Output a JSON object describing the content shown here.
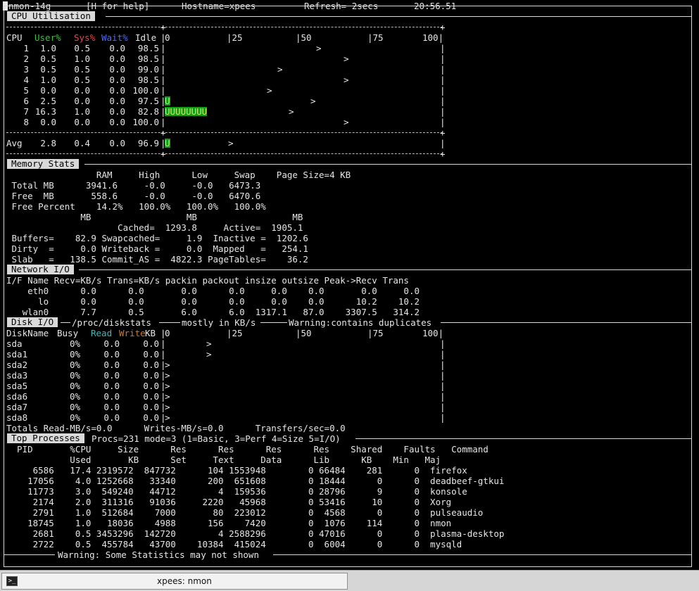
{
  "title_bar": {
    "app": "nmon",
    "version": "14g",
    "help": "[H for help]",
    "hostname": "Hostname=xpees",
    "refresh": "Refresh= 2secs",
    "clock": "20:56.51"
  },
  "cpu": {
    "header": "CPU Utilisation",
    "col_cpu": "CPU",
    "col_user": "User%",
    "col_sys": "Sys%",
    "col_wait": "Wait%",
    "col_idle": "Idle",
    "scale": [
      "0",
      "25",
      "50",
      "75",
      "100"
    ],
    "rows": [
      {
        "cpu": "1",
        "user": "1.0",
        "sys": "0.5",
        "wait": "0.0",
        "idle": "98.5",
        "bar": "",
        "peak": 0.55
      },
      {
        "cpu": "2",
        "user": "0.5",
        "sys": "1.0",
        "wait": "0.0",
        "idle": "98.5",
        "bar": "",
        "peak": 0.65
      },
      {
        "cpu": "3",
        "user": "0.5",
        "sys": "0.5",
        "wait": "0.0",
        "idle": "99.0",
        "bar": "",
        "peak": 0.41
      },
      {
        "cpu": "4",
        "user": "1.0",
        "sys": "0.5",
        "wait": "0.0",
        "idle": "98.5",
        "bar": "",
        "peak": 0.65
      },
      {
        "cpu": "5",
        "user": "0.0",
        "sys": "0.0",
        "wait": "0.0",
        "idle": "100.0",
        "bar": "",
        "peak": 0.37
      },
      {
        "cpu": "6",
        "user": "2.5",
        "sys": "0.0",
        "wait": "0.0",
        "idle": "97.5",
        "bar": "U",
        "peak": 0.53
      },
      {
        "cpu": "7",
        "user": "16.3",
        "sys": "1.0",
        "wait": "0.0",
        "idle": "82.8",
        "bar": "UUUUUUUU",
        "peak": 0.45
      },
      {
        "cpu": "8",
        "user": "0.0",
        "sys": "0.0",
        "wait": "0.0",
        "idle": "100.0",
        "bar": "",
        "peak": 0.65
      }
    ],
    "avg": {
      "label": "Avg",
      "user": "2.8",
      "sys": "0.4",
      "wait": "0.0",
      "idle": "96.9",
      "bar": "U",
      "peak": 0.23
    }
  },
  "memory": {
    "header": "Memory Stats",
    "lines": [
      "                 RAM     High      Low     Swap    Page Size=4 KB",
      " Total MB      3941.6     -0.0     -0.0   6473.3",
      " Free  MB       558.6     -0.0     -0.0   6470.6",
      " Free Percent    14.2%   100.0%   100.0%   100.0%",
      "              MB                  MB                  MB",
      "                     Cached=  1293.8     Active=  1905.1",
      " Buffers=    82.9 Swapcached=     1.9  Inactive =  1202.6",
      " Dirty  =     0.0 Writeback =     0.0  Mapped   =   254.1",
      " Slab   =   138.5 Commit_AS =  4822.3 PageTables=    36.2"
    ]
  },
  "network": {
    "header": "Network I/O",
    "lines": [
      "I/F Name Recv=KB/s Trans=KB/s packin packout insize outsize Peak->Recv Trans",
      "    eth0      0.0      0.0       0.0      0.0     0.0    0.0       0.0     0.0",
      "      lo      0.0      0.0       0.0      0.0     0.0    0.0      10.2    10.2",
      "   wlan0      7.7      0.5       6.0      6.0  1317.1   87.0    3307.5   314.2"
    ]
  },
  "disk": {
    "header": "Disk I/O",
    "source": "/proc/diskstats",
    "units_note": "mostly in KB/s",
    "warning": "Warning:contains duplicates",
    "col_name": "DiskName",
    "col_busy": "Busy",
    "col_read": "Read",
    "col_write": "Write",
    "col_unit": "KB",
    "scale": [
      "0",
      "25",
      "50",
      "75",
      "100"
    ],
    "rows": [
      {
        "name": "sda",
        "busy": "0%",
        "read": "0.0",
        "write": "0.0",
        "peak": 0.15
      },
      {
        "name": "sda1",
        "busy": "0%",
        "read": "0.0",
        "write": "0.0",
        "peak": 0.15
      },
      {
        "name": "sda2",
        "busy": "0%",
        "read": "0.0",
        "write": "0.0",
        "peak": 0.0
      },
      {
        "name": "sda3",
        "busy": "0%",
        "read": "0.0",
        "write": "0.0",
        "peak": 0.0
      },
      {
        "name": "sda5",
        "busy": "0%",
        "read": "0.0",
        "write": "0.0",
        "peak": 0.0
      },
      {
        "name": "sda6",
        "busy": "0%",
        "read": "0.0",
        "write": "0.0",
        "peak": 0.0
      },
      {
        "name": "sda7",
        "busy": "0%",
        "read": "0.0",
        "write": "0.0",
        "peak": 0.0
      },
      {
        "name": "sda8",
        "busy": "0%",
        "read": "0.0",
        "write": "0.0",
        "peak": 0.0
      }
    ],
    "totals": "Totals Read-MB/s=0.0      Writes-MB/s=0.0      Transfers/sec=0.0"
  },
  "processes": {
    "header": "Top Processes",
    "summary": "Procs=231 mode=3 (1=Basic, 3=Perf 4=Size 5=I/O)",
    "head1": "  PID       %CPU     Size      Res      Res      Res      Res    Shared    Faults   Command",
    "head2": "            Used       KB      Set     Text     Data      Lib      KB    Min   Maj",
    "rows": [
      "     6586   17.4 2319572  847732      104 1553948        0 66484    281      0  firefox",
      "    17056    4.0 1252668   33340      200  651608        0 18444      0      0  deadbeef-gtkui",
      "    11773    3.0  549240   44712        4  159536        0 28796      9      0  konsole",
      "     2174    2.0  311316   91036     2220   45968        0 53416     10      0  Xorg",
      "     2791    1.0  512684    7000       80  223012        0  4568      0      0  pulseaudio",
      "    18745    1.0   18036    4988      156    7420        0  1076    114      0  nmon",
      "     2681    0.5 3453296  142720        4 2588296        0 47016      0      0  plasma-desktop",
      "     2722    0.5  455784   43700    10384  415024        0  6004      0      0  mysqld"
    ],
    "footer": "Warning: Some Statistics may not shown"
  },
  "taskbar": {
    "icon": "terminal-icon",
    "task_label": "xpees: nmon"
  }
}
